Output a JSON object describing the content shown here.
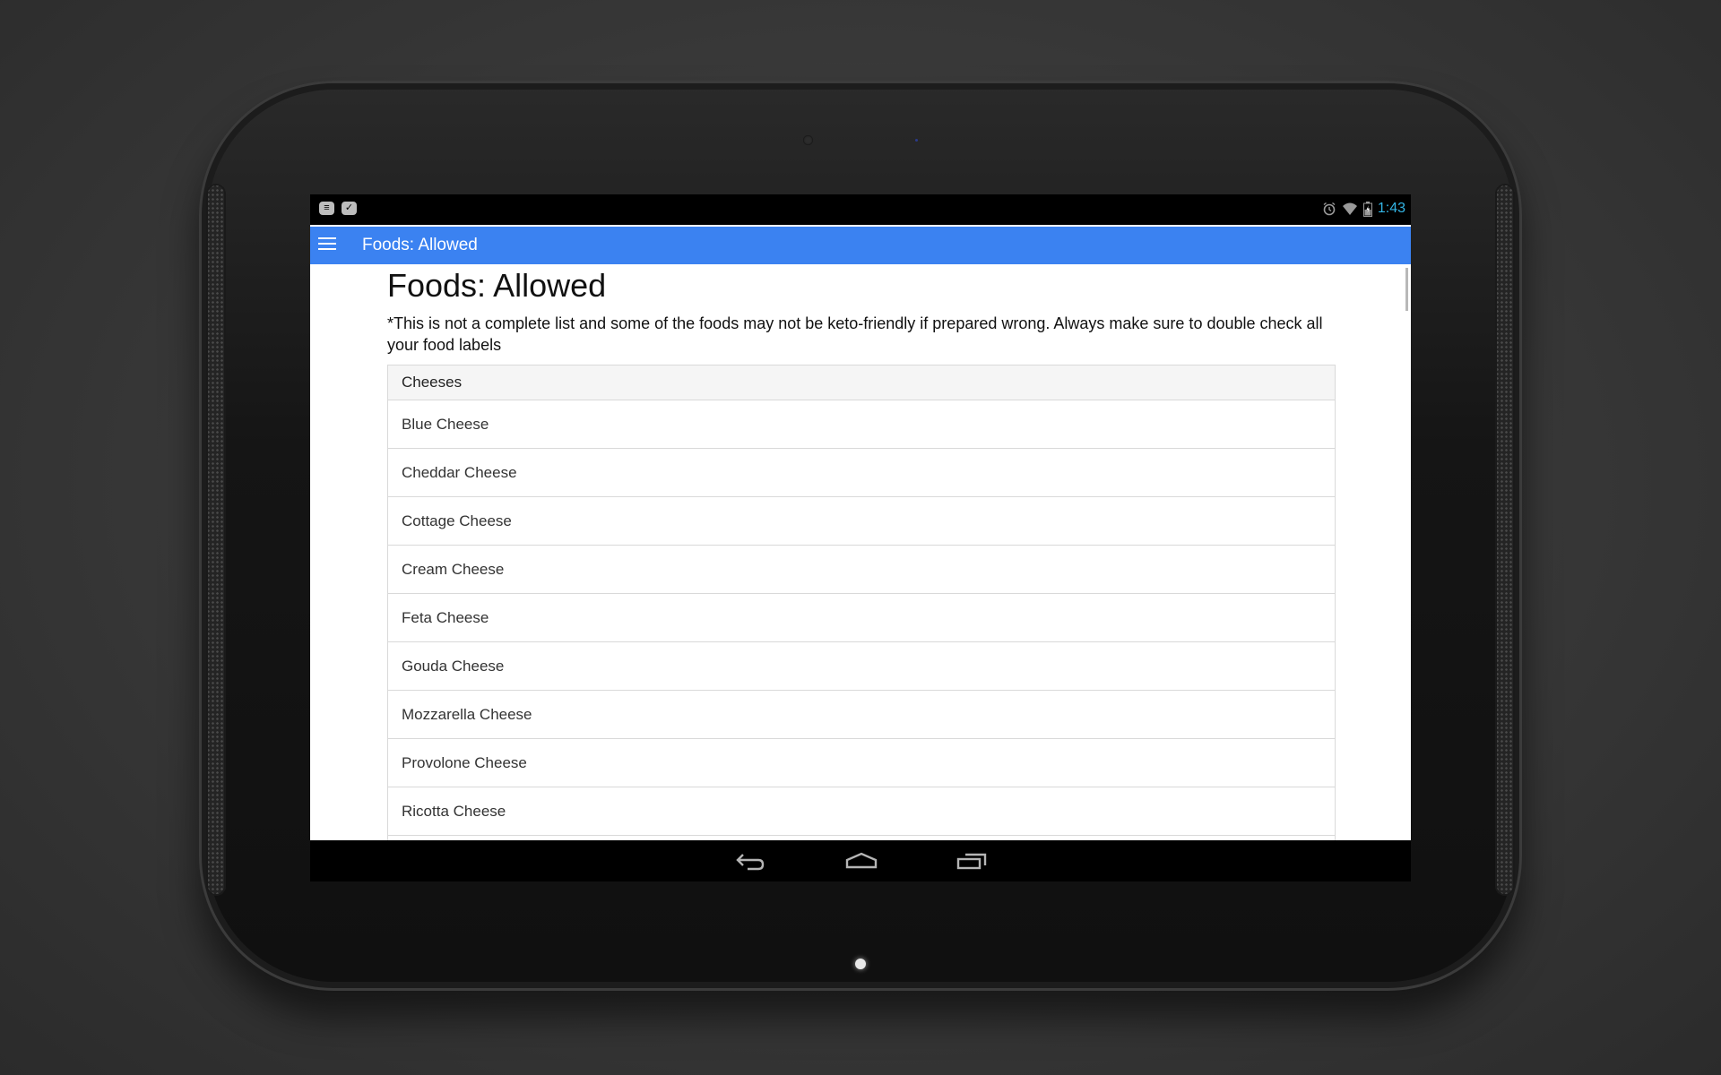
{
  "status_bar": {
    "notifications": [
      {
        "icon": "chat-notification-icon",
        "glyph": "≡"
      },
      {
        "icon": "check-notification-icon",
        "glyph": "✓"
      }
    ],
    "icons": [
      "alarm-icon",
      "wifi-icon",
      "battery-icon"
    ],
    "time": "1:43"
  },
  "app_bar": {
    "title": "Foods: Allowed",
    "menu_icon": "hamburger-menu-icon"
  },
  "page": {
    "title": "Foods: Allowed",
    "disclaimer": "*This is not a complete list and some of the foods may not be keto-friendly if prepared wrong. Always make sure to double check all your food labels"
  },
  "food_table": {
    "header": "Cheeses",
    "rows": [
      "Blue Cheese",
      "Cheddar Cheese",
      "Cottage Cheese",
      "Cream Cheese",
      "Feta Cheese",
      "Gouda Cheese",
      "Mozzarella Cheese",
      "Provolone Cheese",
      "Ricotta Cheese",
      ""
    ]
  },
  "nav_bar": {
    "buttons": [
      "back-icon",
      "home-icon",
      "recent-apps-icon"
    ]
  },
  "colors": {
    "app_bar": "#3b82f1",
    "clock": "#33b5e5",
    "table_header_bg": "#f5f5f5",
    "border": "#d9d9d9"
  }
}
